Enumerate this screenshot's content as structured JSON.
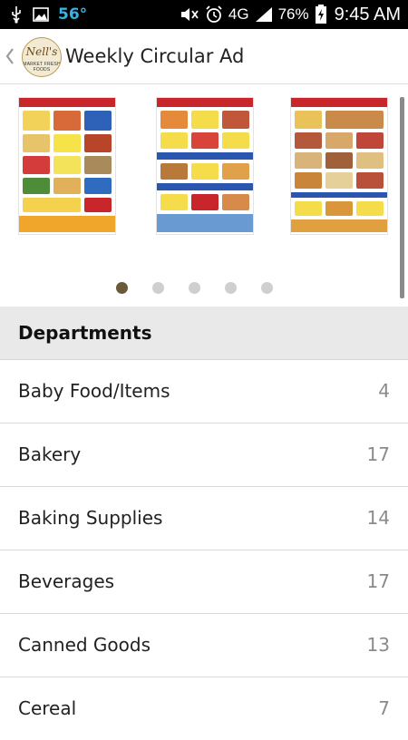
{
  "status_bar": {
    "temperature": "56°",
    "network": "4G",
    "battery": "76%",
    "time": "9:45 AM",
    "icons": [
      "usb-icon",
      "image-icon",
      "mute-icon",
      "alarm-icon",
      "signal-icon",
      "battery-charging-icon"
    ]
  },
  "action_bar": {
    "title": "Weekly Circular Ad",
    "logo_text": "Nell's",
    "logo_subtext": "MARKET FRESH FOODS",
    "back_icon": "chevron-left-icon"
  },
  "carousel": {
    "pages": [
      "circular-page-1",
      "circular-page-2",
      "circular-page-3"
    ],
    "page_count": 5,
    "active_page": 1
  },
  "departments": {
    "header": "Departments",
    "items": [
      {
        "label": "Baby Food/Items",
        "count": "4"
      },
      {
        "label": "Bakery",
        "count": "17"
      },
      {
        "label": "Baking Supplies",
        "count": "14"
      },
      {
        "label": "Beverages",
        "count": "17"
      },
      {
        "label": "Canned Goods",
        "count": "13"
      },
      {
        "label": "Cereal",
        "count": "7"
      }
    ]
  },
  "colors": {
    "accent_blue": "#33b5e5",
    "dot_active": "#6b5a3a",
    "dot_inactive": "#cfcfcf",
    "header_bg": "#e9e9e9"
  }
}
